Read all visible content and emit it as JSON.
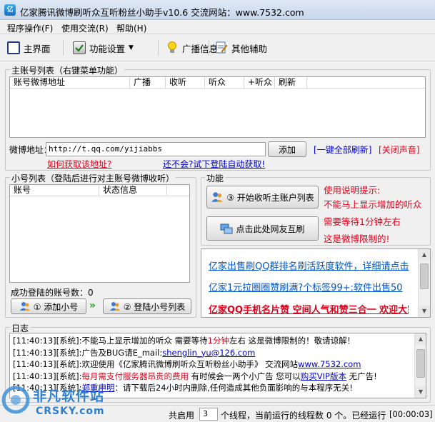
{
  "window": {
    "title": "亿家腾讯微博刷听众互听粉丝小助手v10.6    交流网站：www.7532.com"
  },
  "menu": [
    "程序操作(F)",
    "使用交流(R)",
    "帮助(H)"
  ],
  "toolbar": {
    "main": "主界面",
    "settings": "功能设置",
    "broadcast": "广播信息",
    "other": "其他辅助"
  },
  "main_account": {
    "group_title": "主账号列表（右键菜单功能）",
    "columns": [
      "账号微博地址",
      "广播",
      "收听",
      "听众",
      "+听众",
      "刷新"
    ],
    "weibo_label": "微博地址：",
    "weibo_value": "http://t.qq.com/yijiabbs",
    "add_button": "添加",
    "refresh_all": "一键全部刷新",
    "mute": "关闭声音",
    "how_to_get": "如何获取该地址?",
    "auto_get": "还不会?试下登陆自动获取!"
  },
  "sub_account": {
    "group_title": "小号列表（登陆后进行对主账号微博收听）",
    "columns": [
      "账号",
      "状态信息"
    ],
    "success_label": "成功登陆的账号数：",
    "success_count": "0",
    "add_button": "① 添加小号",
    "login_button": "② 登陆小号列表"
  },
  "function": {
    "group_title": "功能",
    "start_button": "③ 开始收听主账户列表",
    "friends_button": "点击此处网友互刷",
    "help": [
      "使用说明提示:",
      "不能马上显示增加的听众",
      "需要等待1分钟左右",
      "这是微博限制的!"
    ]
  },
  "ads": [
    "亿家出售刷QQ群排名刷活跃度软件，详细请点击",
    "亿家1元拉圈圈赞刷满?个标签99+:软件出售50",
    "亿家QQ手机名片赞  空间人气和赞三合一  欢迎大家下载"
  ],
  "log": {
    "group_title": "日志",
    "lines": [
      {
        "time": "[11:40:13]",
        "parts": [
          "[系统]:不能马上显示增加的听众  需要等待",
          "1分钟",
          "左右  这是微博限制的！敬请谅解！"
        ]
      },
      {
        "time": "[11:40:13]",
        "parts": [
          "[系统]:广告及BUG请E_mail:",
          "shenglin_yu@126.com",
          ""
        ]
      },
      {
        "time": "[11:40:13]",
        "parts": [
          "[系统]:欢迎使用《亿家腾讯微博刷听众互听粉丝小助手》  交流网站",
          "www.7532.com",
          ""
        ]
      },
      {
        "time": "[11:40:13]",
        "parts": [
          "[系统]:",
          "每月需支付服务器昂贵的费用",
          "  有时候会一两个小广告  您可以",
          "购买VIP版本",
          "  无广告!"
        ]
      },
      {
        "time": "[11:40:13]",
        "parts": [
          "[系统]:",
          "郑重申明",
          "：请下载后24小时内删除,任何造成其他负面影响的与本程序无关!"
        ]
      }
    ]
  },
  "status": {
    "threads_prefix": "共启用",
    "threads_value": "3",
    "threads_suffix": "个线程，当前运行的线程数 0 个。已经运行",
    "elapsed": "[00:00:03]"
  },
  "watermark": {
    "cn": "非凡软件站",
    "en": "CRSKY.com"
  },
  "colors": {
    "accent_red": "#e0001a",
    "link_blue": "#0000d0"
  }
}
